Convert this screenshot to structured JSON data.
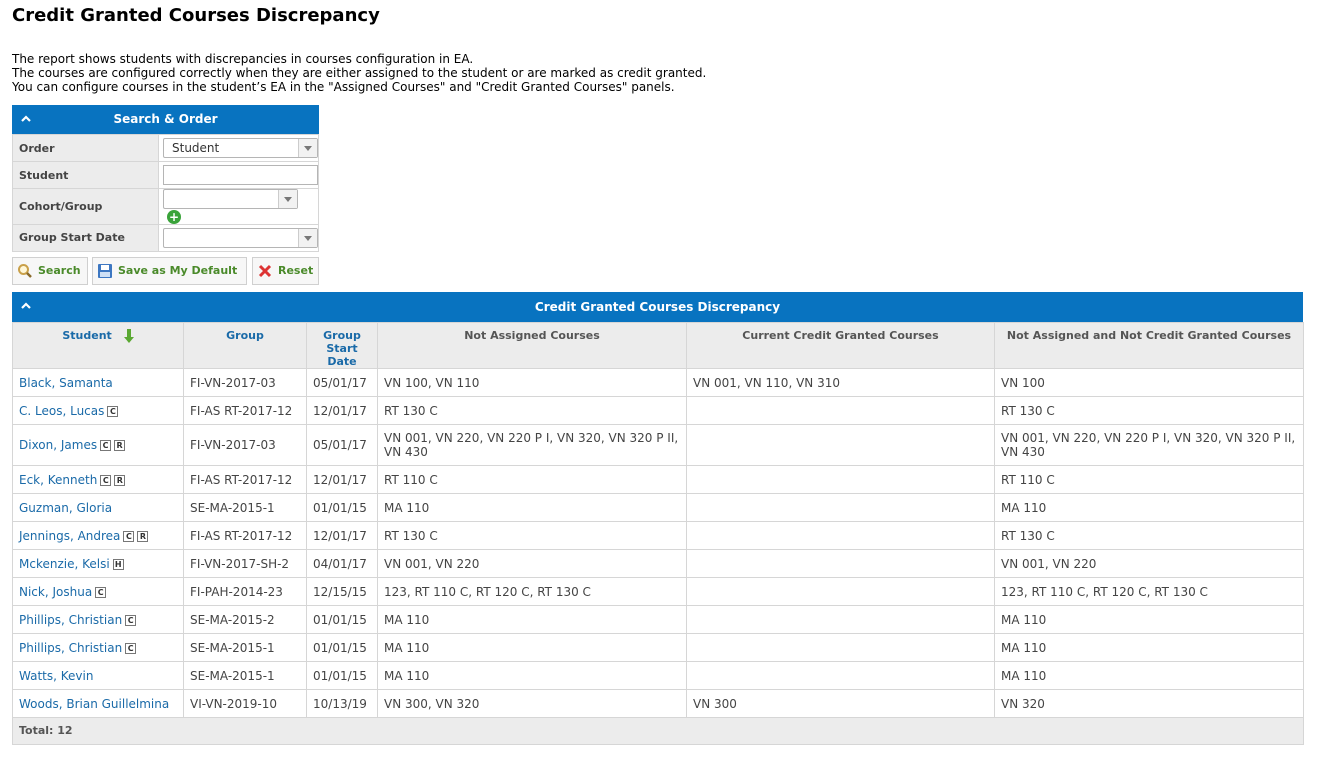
{
  "page": {
    "title": "Credit Granted Courses Discrepancy",
    "intro": [
      "The report shows students with discrepancies in courses configuration in EA.",
      "The courses are configured correctly when they are either assigned to the student or are marked as credit granted.",
      "You can configure courses in the student’s EA in the \"Assigned Courses\" and \"Credit Granted Courses\" panels."
    ]
  },
  "search": {
    "title": "Search & Order",
    "labels": {
      "order": "Order",
      "student": "Student",
      "cohort": "Cohort/Group",
      "start_date": "Group Start Date"
    },
    "order_value": "Student",
    "student_value": "",
    "cohort_value": "",
    "start_date_value": "",
    "buttons": {
      "search": "Search",
      "save_default": "Save as My Default",
      "reset": "Reset"
    }
  },
  "report": {
    "title": "Credit Granted Courses Discrepancy",
    "columns": {
      "student": "Student",
      "group_l1": "Group",
      "start_l1": "Group",
      "start_l2": "Start",
      "start_l3": "Date",
      "not_assigned": "Not Assigned Courses",
      "current_cg": "Current Credit Granted Courses",
      "not_assigned_not_cg": "Not Assigned and Not Credit Granted Courses"
    },
    "rows": [
      {
        "student": "Black, Samanta",
        "badges": [],
        "group": "FI-VN-2017-03",
        "date": "05/01/17",
        "not_assigned": "VN 100, VN 110",
        "current_cg": "VN 001, VN 110, VN 310",
        "neither": "VN 100"
      },
      {
        "student": "C. Leos, Lucas",
        "badges": [
          "C"
        ],
        "group": "FI-AS RT-2017-12",
        "date": "12/01/17",
        "not_assigned": "RT 130 C",
        "current_cg": "",
        "neither": "RT 130 C"
      },
      {
        "student": "Dixon, James",
        "badges": [
          "C",
          "R"
        ],
        "group": "FI-VN-2017-03",
        "date": "05/01/17",
        "not_assigned": "VN 001, VN 220, VN 220 P I, VN 320, VN 320 P II, VN 430",
        "current_cg": "",
        "neither": "VN 001, VN 220, VN 220 P I, VN 320, VN 320 P II, VN 430"
      },
      {
        "student": "Eck, Kenneth",
        "badges": [
          "C",
          "R"
        ],
        "group": "FI-AS RT-2017-12",
        "date": "12/01/17",
        "not_assigned": "RT 110 C",
        "current_cg": "",
        "neither": "RT 110 C"
      },
      {
        "student": "Guzman, Gloria",
        "badges": [],
        "group": "SE-MA-2015-1",
        "date": "01/01/15",
        "not_assigned": "MA 110",
        "current_cg": "",
        "neither": "MA 110"
      },
      {
        "student": "Jennings, Andrea",
        "badges": [
          "C",
          "R"
        ],
        "group": "FI-AS RT-2017-12",
        "date": "12/01/17",
        "not_assigned": "RT 130 C",
        "current_cg": "",
        "neither": "RT 130 C"
      },
      {
        "student": "Mckenzie, Kelsi",
        "badges": [
          "H"
        ],
        "group": "FI-VN-2017-SH-2",
        "date": "04/01/17",
        "not_assigned": "VN 001, VN 220",
        "current_cg": "",
        "neither": "VN 001, VN 220"
      },
      {
        "student": "Nick, Joshua",
        "badges": [
          "C"
        ],
        "group": "FI-PAH-2014-23",
        "date": "12/15/15",
        "not_assigned": "123, RT 110 C, RT 120 C, RT 130 C",
        "current_cg": "",
        "neither": "123, RT 110 C, RT 120 C, RT 130 C"
      },
      {
        "student": "Phillips, Christian",
        "badges": [
          "C"
        ],
        "group": "SE-MA-2015-2",
        "date": "01/01/15",
        "not_assigned": "MA 110",
        "current_cg": "",
        "neither": "MA 110"
      },
      {
        "student": "Phillips, Christian",
        "badges": [
          "C"
        ],
        "group": "SE-MA-2015-1",
        "date": "01/01/15",
        "not_assigned": "MA 110",
        "current_cg": "",
        "neither": "MA 110"
      },
      {
        "student": "Watts, Kevin",
        "badges": [],
        "group": "SE-MA-2015-1",
        "date": "01/01/15",
        "not_assigned": "MA 110",
        "current_cg": "",
        "neither": "MA 110"
      },
      {
        "student": "Woods, Brian Guillelmina",
        "badges": [],
        "group": "VI-VN-2019-10",
        "date": "10/13/19",
        "not_assigned": "VN 300, VN 320",
        "current_cg": "VN 300",
        "neither": "VN 320"
      }
    ],
    "total": "Total: 12"
  },
  "colors": {
    "header_blue": "#0873c0",
    "link_blue": "#1a6aa8",
    "button_green_text": "#4a8a2a",
    "sort_arrow": "#5aa832"
  },
  "icons": [
    "chevron-up-icon",
    "dropdown-arrow-icon",
    "add-icon",
    "magnifier-icon",
    "save-icon",
    "close-icon",
    "sort-down-arrow-icon",
    "course-badge-icon",
    "restricted-badge-icon",
    "home-badge-icon"
  ]
}
